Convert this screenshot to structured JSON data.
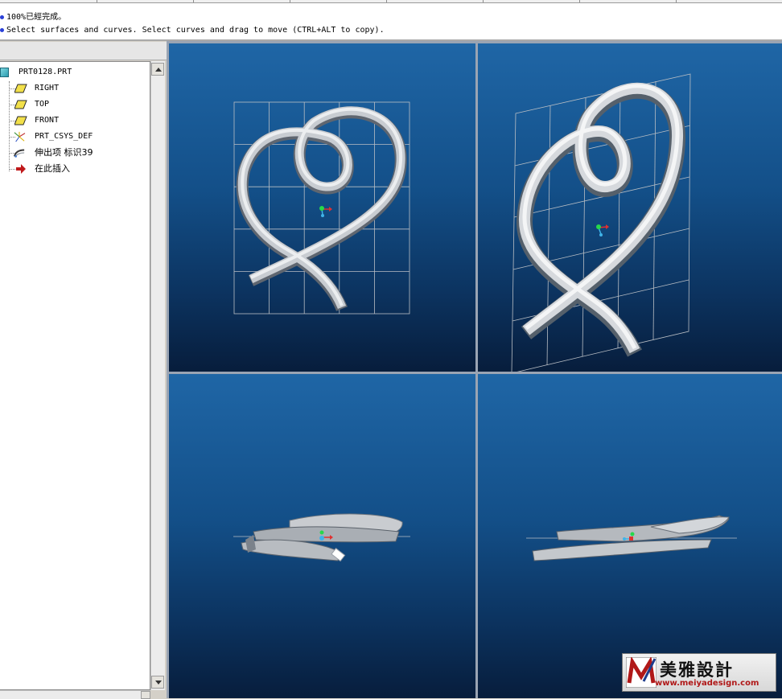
{
  "messages": [
    "100%已經完成。",
    "Select surfaces and curves.  Select curves and drag to move (CTRL+ALT to copy)."
  ],
  "model_tree": {
    "root": "PRT0128.PRT",
    "items": [
      {
        "label": "RIGHT",
        "icon": "datum-plane-icon"
      },
      {
        "label": "TOP",
        "icon": "datum-plane-icon"
      },
      {
        "label": "FRONT",
        "icon": "datum-plane-icon"
      },
      {
        "label": "PRT_CSYS_DEF",
        "icon": "coordinate-system-icon"
      },
      {
        "label": "伸出项 标识39",
        "icon": "protrusion-icon"
      },
      {
        "label": "在此插入",
        "icon": "insert-here-arrow-icon"
      }
    ]
  },
  "viewports": [
    "front-view",
    "isometric-view",
    "top-view",
    "side-view"
  ],
  "watermark": {
    "brand": "美雅設計",
    "url": "www.meiyadesign.com"
  },
  "colors": {
    "viewport_top": "#1f66a6",
    "viewport_bottom": "#071d3c",
    "datum_plane_icon": "#f2e04a",
    "insert_arrow": "#c0191b",
    "message_bullet": "#2a40d8"
  }
}
